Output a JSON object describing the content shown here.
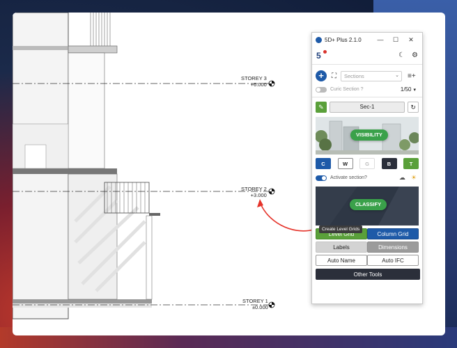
{
  "levels": [
    {
      "name": "STOREY 3",
      "elevation": "+6.000"
    },
    {
      "name": "STOREY 2",
      "elevation": "+3.000"
    },
    {
      "name": "STOREY 1",
      "elevation": "±0.000"
    }
  ],
  "plugin": {
    "title": "5D+ Plus 2.1.0",
    "window_controls": {
      "minimize": "—",
      "maximize": "☐",
      "close": "✕"
    },
    "toolbar": {
      "app_icon": "5",
      "theme_icon": "☾",
      "settings_icon": "⚙"
    },
    "sections_row": {
      "plus": "+",
      "expand_icon": "⛶",
      "placeholder": "Sections",
      "chevron": "⌄",
      "addlist_icon": "≡+"
    },
    "curic_section": {
      "label": "Curic Section ?",
      "scale": "1/50",
      "chevron": "▾"
    },
    "section_row": {
      "wand_icon": "✎",
      "value": "Sec-1",
      "refresh_icon": "↻"
    },
    "visibility_label": "VISIBILITY",
    "filters": [
      {
        "label": "C",
        "bg": "#1e5aa8",
        "fg": "#ffffff",
        "border": "#1e5aa8"
      },
      {
        "label": "W",
        "bg": "#ffffff",
        "fg": "#222222",
        "border": "#8a8a8a"
      },
      {
        "label": "G",
        "bg": "#ffffff",
        "fg": "#bbbbbb",
        "border": "#dddddd"
      },
      {
        "label": "B",
        "bg": "#2b2f3a",
        "fg": "#ffffff",
        "border": "#2b2f3a"
      },
      {
        "label": "T",
        "bg": "#5aa03a",
        "fg": "#ffffff",
        "border": "#5aa03a"
      }
    ],
    "activate_section": {
      "label": "Activate section?",
      "cloud_icon": "☁",
      "sun_icon": "☀"
    },
    "classify_label": "CLASSIFY",
    "tooltip": "Create Level Grids",
    "buttons": {
      "level_grid": "Level Grid",
      "column_grid": "Column Grid",
      "labels": "Labels",
      "dimensions": "Dimensions",
      "auto_name": "Auto Name",
      "auto_ifc": "Auto IFC",
      "other_tools": "Other Tools"
    },
    "colors": {
      "accent_blue": "#1e5aa8",
      "accent_green": "#5aa03a",
      "dark": "#2b2f3a",
      "annotation_red": "#e5332a"
    }
  }
}
